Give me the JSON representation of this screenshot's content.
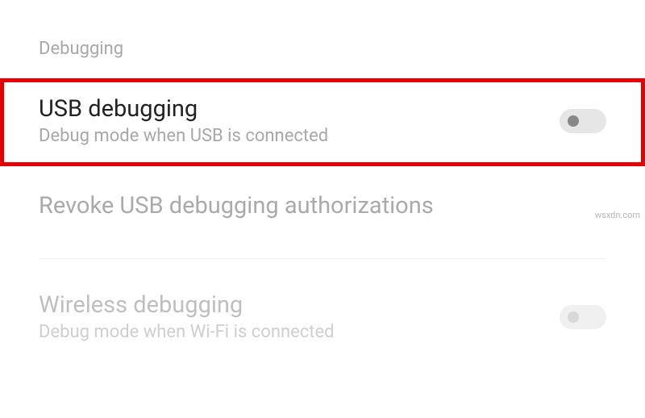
{
  "section": {
    "header": "Debugging"
  },
  "usb_debugging": {
    "title": "USB debugging",
    "subtitle": "Debug mode when USB is connected",
    "enabled": false
  },
  "revoke": {
    "title": "Revoke USB debugging authorizations"
  },
  "wireless_debugging": {
    "title": "Wireless debugging",
    "subtitle": "Debug mode when Wi-Fi is connected",
    "enabled": false
  },
  "watermark": "wsxdn.com"
}
